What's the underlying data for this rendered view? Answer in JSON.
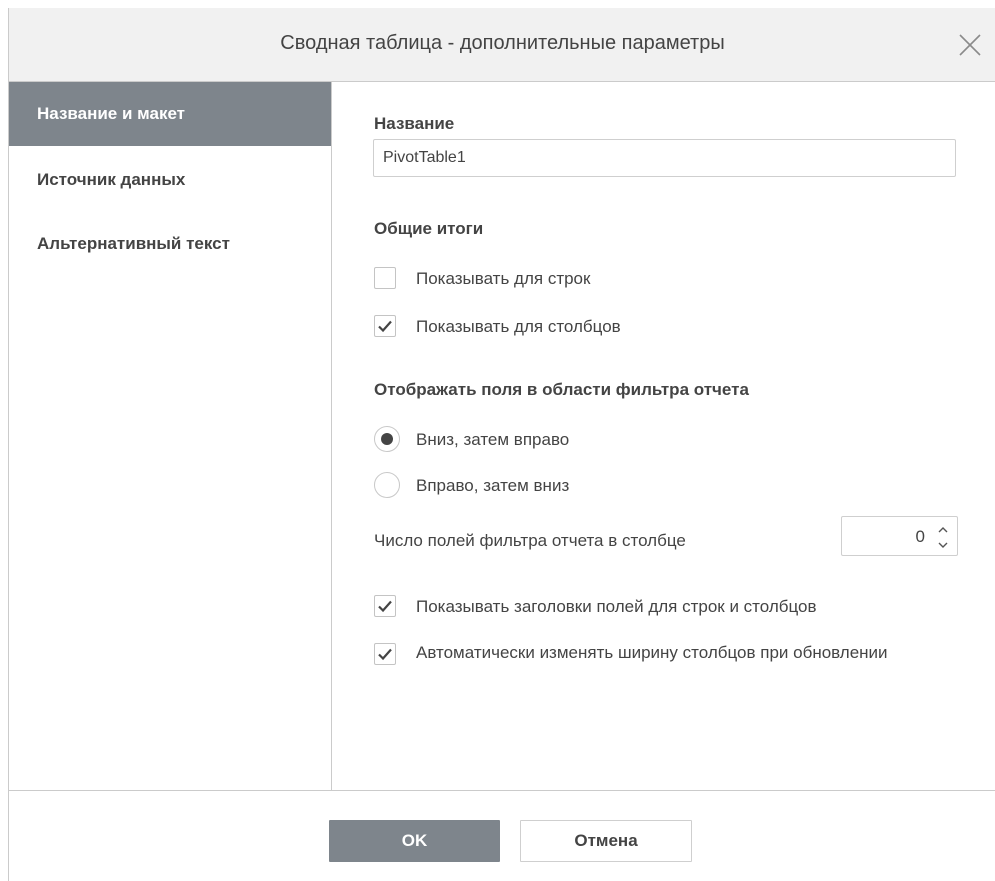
{
  "dialog": {
    "title": "Сводная таблица - дополнительные параметры"
  },
  "sidebar": {
    "items": [
      {
        "label": "Название и макет",
        "active": true
      },
      {
        "label": "Источник данных",
        "active": false
      },
      {
        "label": "Альтернативный текст",
        "active": false
      }
    ]
  },
  "name_section": {
    "label": "Название",
    "value": "PivotTable1",
    "placeholder": ""
  },
  "grand_totals": {
    "label": "Общие итоги",
    "show_rows": {
      "label": "Показывать для строк",
      "checked": false
    },
    "show_columns": {
      "label": "Показывать для столбцов",
      "checked": true
    }
  },
  "filter_area": {
    "label": "Отображать поля в области фильтра отчета",
    "down_then_right": {
      "label": "Вниз, затем вправо",
      "selected": true
    },
    "right_then_down": {
      "label": "Вправо, затем вниз",
      "selected": false
    },
    "fields_per_column_label": "Число полей фильтра отчета в столбце",
    "fields_per_column_value": "0"
  },
  "options": {
    "show_headers": {
      "label": "Показывать заголовки полей для строк и столбцов",
      "checked": true
    },
    "autofit_columns": {
      "label": "Автоматически изменять ширину столбцов при обновлении",
      "checked": true
    }
  },
  "footer": {
    "ok_label": "OK",
    "cancel_label": "Отмена"
  },
  "colors": {
    "accent_gray": "#7e858c",
    "text": "#444444",
    "header_bg": "#f1f1f1",
    "border": "#cbcbcb"
  }
}
